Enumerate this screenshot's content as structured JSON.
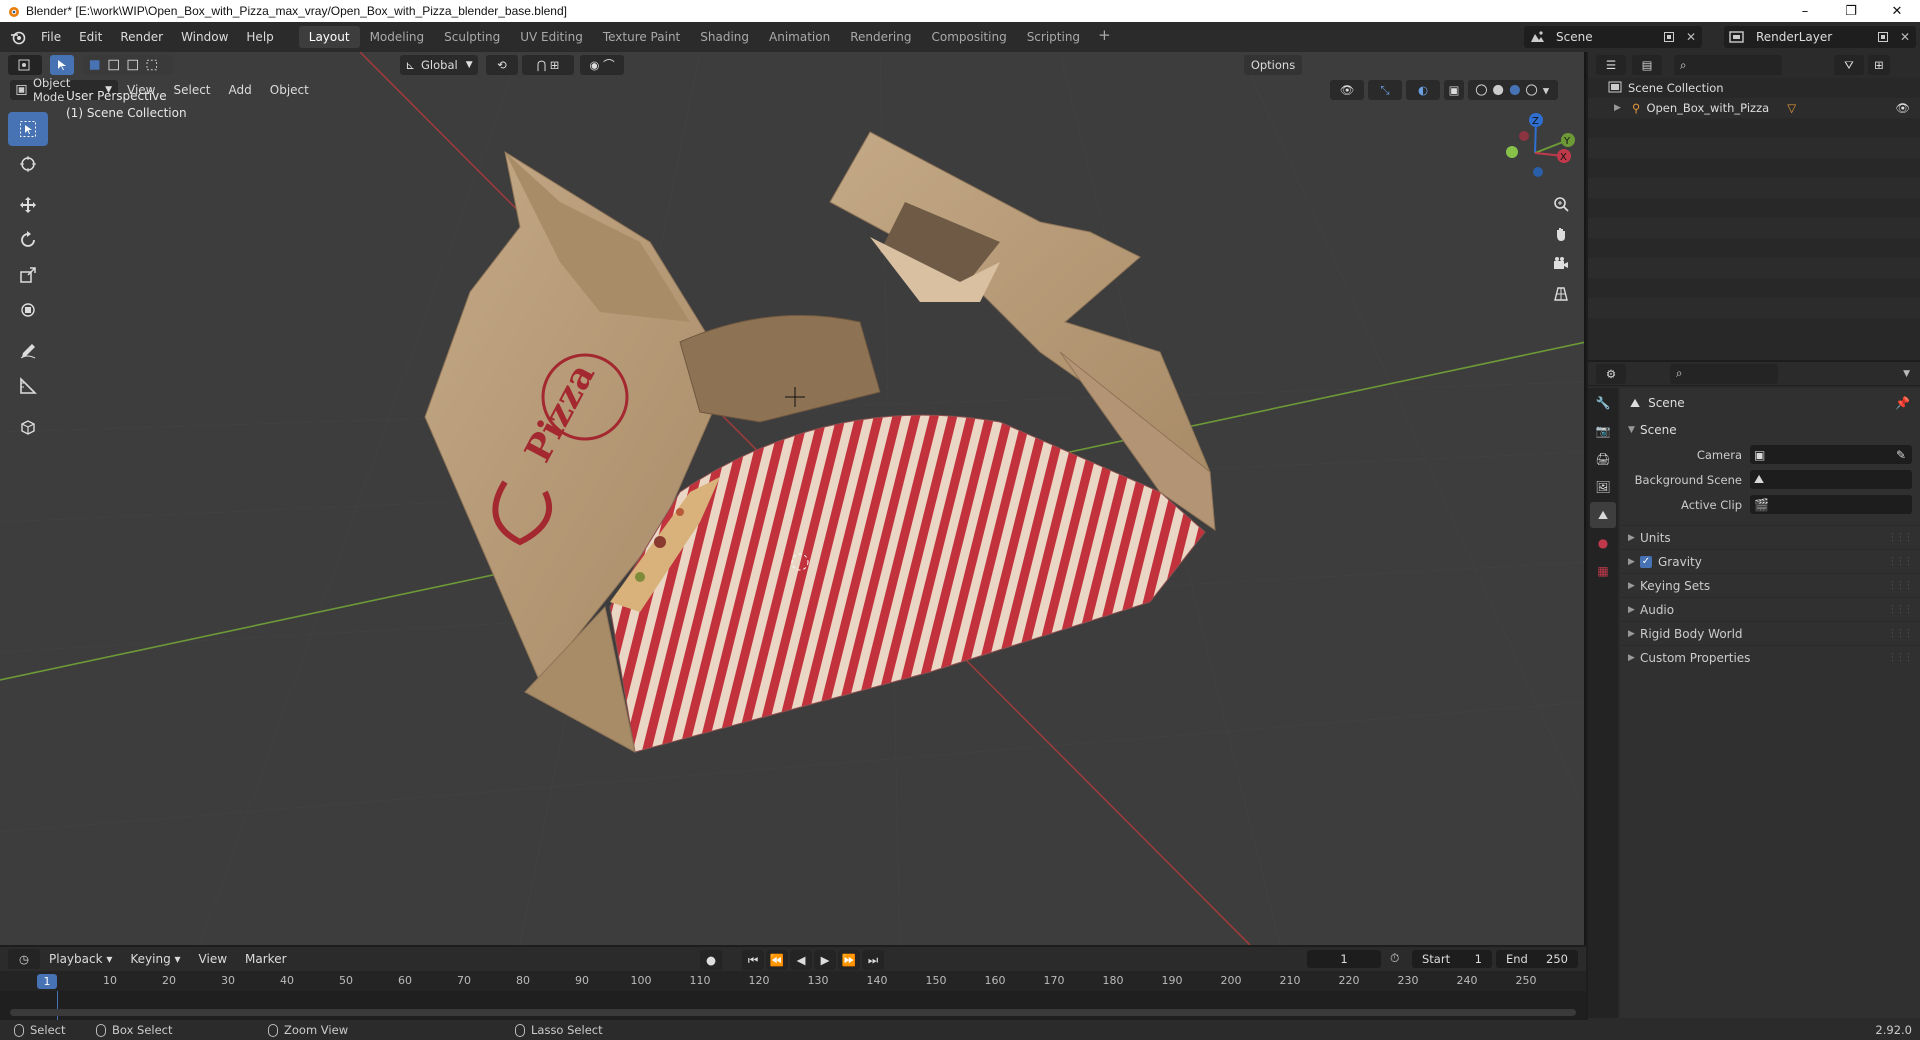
{
  "window": {
    "title": "Blender* [E:\\work\\WIP\\Open_Box_with_Pizza_max_vray/Open_Box_with_Pizza_blender_base.blend]",
    "controls": [
      "–",
      "❐",
      "✕"
    ]
  },
  "menu": [
    "File",
    "Edit",
    "Render",
    "Window",
    "Help"
  ],
  "workspaces": [
    {
      "label": "Layout",
      "active": true
    },
    {
      "label": "Modeling"
    },
    {
      "label": "Sculpting"
    },
    {
      "label": "UV Editing"
    },
    {
      "label": "Texture Paint"
    },
    {
      "label": "Shading"
    },
    {
      "label": "Animation"
    },
    {
      "label": "Rendering"
    },
    {
      "label": "Compositing"
    },
    {
      "label": "Scripting"
    }
  ],
  "scene_selector": {
    "value": "Scene"
  },
  "renderlayer_selector": {
    "value": "RenderLayer"
  },
  "viewport_header": {
    "transform_orientation": "Global",
    "options_label": "Options",
    "mode": "Object Mode",
    "menus": [
      "View",
      "Select",
      "Add",
      "Object"
    ]
  },
  "viewport": {
    "perspective_label": "User Perspective",
    "collection_label": "(1) Scene Collection",
    "box_print_text": "Pizza",
    "axes": {
      "z": "Z",
      "y": "Y",
      "x": "X"
    }
  },
  "outliner": {
    "root": "Scene Collection",
    "items": [
      {
        "label": "Open_Box_with_Pizza",
        "visible": true
      }
    ]
  },
  "properties": {
    "title": "Scene",
    "section": "Scene",
    "fields": [
      {
        "label": "Camera",
        "value": ""
      },
      {
        "label": "Background Scene",
        "value": ""
      },
      {
        "label": "Active Clip",
        "value": ""
      }
    ],
    "subpanels": [
      {
        "label": "Units"
      },
      {
        "label": "Gravity",
        "checked": true
      },
      {
        "label": "Keying Sets"
      },
      {
        "label": "Audio"
      },
      {
        "label": "Rigid Body World"
      },
      {
        "label": "Custom Properties"
      }
    ]
  },
  "timeline": {
    "menus": [
      "Playback",
      "Keying",
      "View",
      "Marker"
    ],
    "current_frame": "1",
    "start_label": "Start",
    "start": "1",
    "end_label": "End",
    "end": "250",
    "ticks": [
      "10",
      "20",
      "30",
      "40",
      "50",
      "60",
      "70",
      "80",
      "90",
      "100",
      "110",
      "120",
      "130",
      "140",
      "150",
      "160",
      "170",
      "180",
      "190",
      "200",
      "210",
      "220",
      "230",
      "240",
      "250"
    ]
  },
  "statusbar": {
    "items": [
      "Select",
      "Box Select",
      "Zoom View",
      "Lasso Select"
    ],
    "version": "2.92.0"
  },
  "colors": {
    "accent": "#4772b3",
    "viewport_bg": "#3d3d3d",
    "x_axis": "#9c3b3b",
    "y_axis": "#6d9a37",
    "cardboard": "#bfa27f",
    "stripe_red": "#c2323c"
  }
}
